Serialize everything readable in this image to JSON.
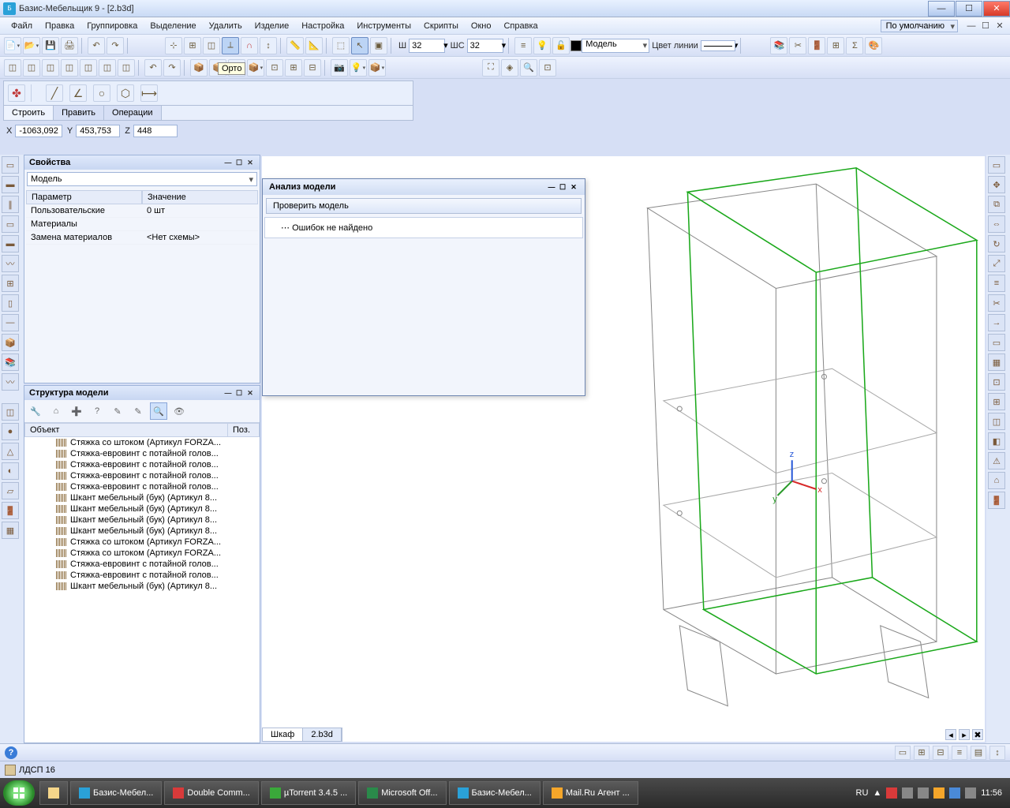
{
  "window": {
    "title": "Базис-Мебельщик 9 - [2.b3d]"
  },
  "menu": {
    "items": [
      "Файл",
      "Правка",
      "Группировка",
      "Выделение",
      "Удалить",
      "Изделие",
      "Настройка",
      "Инструменты",
      "Скрипты",
      "Окно",
      "Справка"
    ],
    "default_combo": "По умолчанию"
  },
  "toolbar": {
    "tooltip": "Орто",
    "w_label": "Ш",
    "w_value": "32",
    "wc_label": "ШС",
    "wc_value": "32",
    "model_label": "Модель",
    "linecolor_label": "Цвет линии"
  },
  "buildpanel": {
    "tabs": [
      "Строить",
      "Править",
      "Операции"
    ]
  },
  "coords": {
    "xl": "X",
    "xv": "-1063,092",
    "yl": "Y",
    "yv": "453,753",
    "zl": "Z",
    "zv": "448"
  },
  "props": {
    "title": "Свойства",
    "selector": "Модель",
    "col_param": "Параметр",
    "col_value": "Значение",
    "rows": [
      {
        "p": "Пользовательские",
        "v": "0 шт"
      },
      {
        "p": "Материалы",
        "v": ""
      },
      {
        "p": "Замена материалов",
        "v": "<Нет схемы>"
      }
    ]
  },
  "struct": {
    "title": "Структура модели",
    "col_obj": "Объект",
    "col_pos": "Поз.",
    "items": [
      "Стяжка со штоком (Артикул FORZA...",
      "Стяжка-евровинт с потайной голов...",
      "Стяжка-евровинт с потайной голов...",
      "Стяжка-евровинт с потайной голов...",
      "Стяжка-евровинт с потайной голов...",
      "Шкант мебельный (бук) (Артикул 8...",
      "Шкант мебельный (бук) (Артикул 8...",
      "Шкант мебельный (бук) (Артикул 8...",
      "Шкант мебельный (бук) (Артикул 8...",
      "Стяжка со штоком (Артикул FORZA...",
      "Стяжка со штоком (Артикул FORZA...",
      "Стяжка-евровинт с потайной голов...",
      "Стяжка-евровинт с потайной голов...",
      "Шкант мебельный (бук) (Артикул 8..."
    ]
  },
  "dialog": {
    "title": "Анализ модели",
    "button": "Проверить модель",
    "result": "Ошибок не найдено"
  },
  "viewtabs": {
    "tab1": "Шкаф",
    "tab2": "2.b3d"
  },
  "status": {
    "material": "ЛДСП 16"
  },
  "taskbar": {
    "items": [
      "Базис-Мебел...",
      "Double Comm...",
      "µTorrent 3.4.5 ...",
      "Microsoft Off...",
      "Базис-Мебел...",
      "Mail.Ru Агент ..."
    ],
    "lang": "RU",
    "time": "11:56"
  }
}
